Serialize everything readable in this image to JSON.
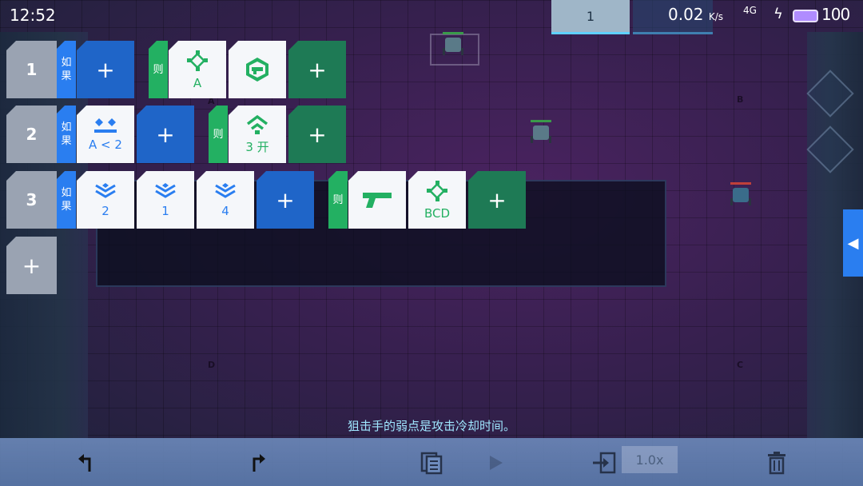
{
  "status_bar": {
    "time": "12:52",
    "tab_number": "1",
    "network_speed": "0.02",
    "network_unit": "K/s",
    "network_type": "4G",
    "battery": "100"
  },
  "map_labels": [
    "A",
    "B",
    "C",
    "D"
  ],
  "rows": [
    {
      "number": "1",
      "if_label": "如果",
      "then_label": "则",
      "conditions": [],
      "actions": [
        {
          "icon": "target-diamond-icon",
          "label": "A"
        },
        {
          "icon": "robot-face-icon",
          "label": ""
        }
      ]
    },
    {
      "number": "2",
      "if_label": "如果",
      "then_label": "则",
      "conditions": [
        {
          "icon": "crown-icon",
          "label": "A < 2"
        }
      ],
      "actions": [
        {
          "icon": "signal-icon",
          "label": "3 开"
        }
      ]
    },
    {
      "number": "3",
      "if_label": "如果",
      "then_label": "则",
      "conditions": [
        {
          "icon": "layers-icon",
          "label": "2"
        },
        {
          "icon": "layers-icon",
          "label": "1"
        },
        {
          "icon": "layers-icon",
          "label": "4"
        }
      ],
      "actions": [
        {
          "icon": "pistol-icon",
          "label": ""
        },
        {
          "icon": "target-diamond-icon",
          "label": "BCD"
        }
      ]
    }
  ],
  "add_symbol": "+",
  "hint_text": "狙击手的弱点是攻击冷却时间。",
  "toolbar": {
    "speed_label": "1.0x",
    "buttons": [
      "undo-icon",
      "redo-icon",
      "copy-icon",
      "play-icon",
      "import-icon",
      "trash-icon"
    ]
  },
  "colors": {
    "if_blue": "#2a7ef0",
    "then_green": "#23b062",
    "add_blue": "#1f65c8",
    "add_green": "#1e7a55"
  }
}
